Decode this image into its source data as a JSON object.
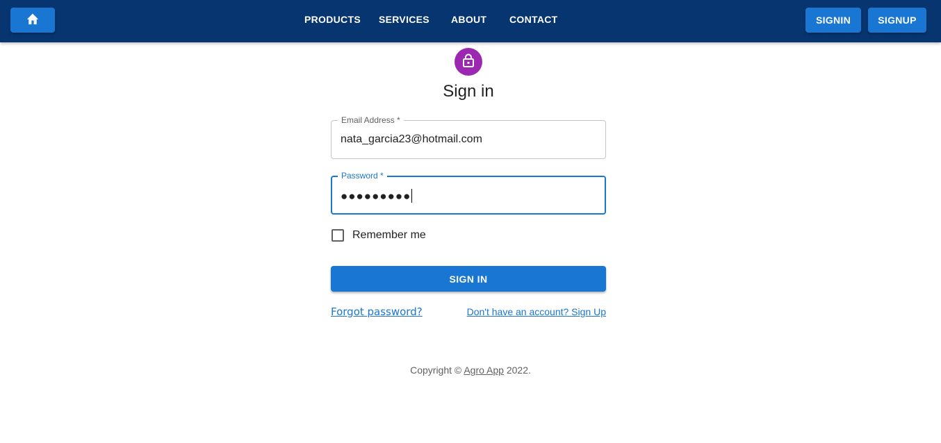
{
  "header": {
    "home_icon": "home-icon",
    "nav": [
      {
        "label": "PRODUCTS"
      },
      {
        "label": "SERVICES"
      },
      {
        "label": "ABOUT"
      },
      {
        "label": "CONTACT"
      }
    ],
    "signin_label": "SIGNIN",
    "signup_label": "SIGNUP",
    "colors": {
      "bar": "#063570",
      "button": "#1976d2"
    }
  },
  "form": {
    "avatar_icon": "lock-icon",
    "avatar_color": "#9c27b0",
    "title": "Sign in",
    "email": {
      "label": "Email Address *",
      "value": "nata_garcia23@hotmail.com"
    },
    "password": {
      "label": "Password *",
      "value": "●●●●●●●●●"
    },
    "remember_label": "Remember me",
    "submit_label": "SIGN IN",
    "forgot_link": "Forgot password?",
    "signup_link": "Don't have an account? Sign Up"
  },
  "footer": {
    "prefix": "Copyright © ",
    "brand": "Agro App",
    "suffix": " 2022."
  }
}
